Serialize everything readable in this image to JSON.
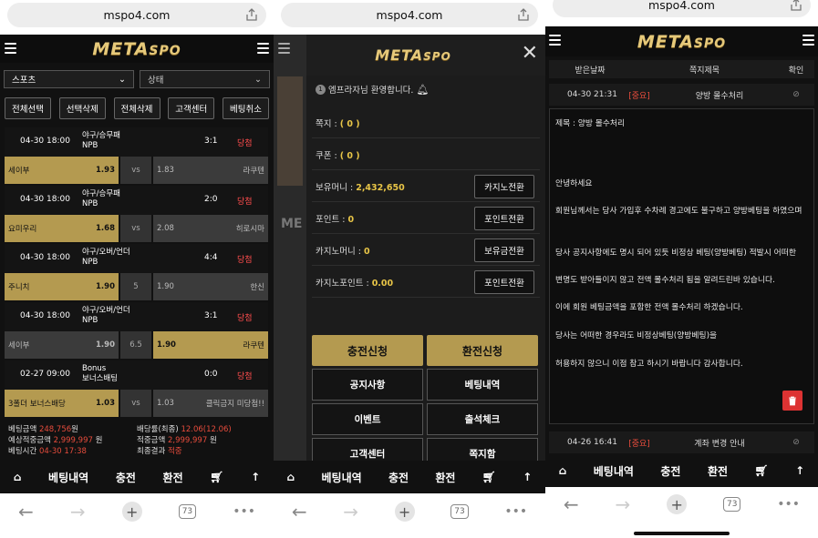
{
  "url": "mspo4.com",
  "logo": {
    "main": "META",
    "sub": "SPO"
  },
  "p1": {
    "sel1": "스포츠",
    "sel2": "상태",
    "btns": [
      "전체선택",
      "선택삭제",
      "전체삭제",
      "고객센터",
      "베팅취소"
    ],
    "bets": [
      {
        "date": "04-30 18:00",
        "league": "야구/승무패",
        "league2": "NPB",
        "score": "3:1",
        "result": "당첨",
        "home": "세이부",
        "hodds": "1.93",
        "mid": "vs",
        "aodds": "1.83",
        "away": "라쿠텐",
        "sel": "home"
      },
      {
        "date": "04-30 18:00",
        "league": "야구/승무패",
        "league2": "NPB",
        "score": "2:0",
        "result": "당첨",
        "home": "요미우리",
        "hodds": "1.68",
        "mid": "vs",
        "aodds": "2.08",
        "away": "히로시마",
        "sel": "home"
      },
      {
        "date": "04-30 18:00",
        "league": "야구/오버/언더",
        "league2": "NPB",
        "score": "4:4",
        "result": "당첨",
        "home": "주니치",
        "hodds": "1.90",
        "mid": "5",
        "aodds": "1.90",
        "away": "한신",
        "sel": "home"
      },
      {
        "date": "04-30 18:00",
        "league": "야구/오버/언더",
        "league2": "NPB",
        "score": "3:1",
        "result": "당첨",
        "home": "세이부",
        "hodds": "1.90",
        "mid": "6.5",
        "aodds": "1.90",
        "away": "라쿠텐",
        "sel": "away"
      },
      {
        "date": "02-27 09:00",
        "league": "Bonus",
        "league2": "보너스배팅",
        "score": "0:0",
        "result": "당첨",
        "home": "3폴더 보너스배당",
        "hodds": "1.03",
        "mid": "vs",
        "aodds": "1.03",
        "away": "클릭금지 미당첨!!",
        "sel": "home"
      }
    ],
    "summary": {
      "l1k": "베팅금액",
      "l1v": "248,756",
      "l1u": "원",
      "l2k": "예상적중금액",
      "l2v": "2,999,997",
      "l2u": "원",
      "l3k": "베팅시간",
      "l3v": "04-30 17:38",
      "r1k": "배당률(최종)",
      "r1v": "12.06(12.06)",
      "r2k": "적중금액",
      "r2v": "2,999,997",
      "r2u": "원",
      "r3k": "최종결과",
      "r3v": "적중"
    }
  },
  "bottom": [
    "베팅내역",
    "충전",
    "환전"
  ],
  "tabs": "73",
  "p2": {
    "welcome": "엠프라자님 환영합니다.",
    "rows": [
      {
        "k": "쪽지 : ",
        "v": "( 0 )"
      },
      {
        "k": "쿠폰 : ",
        "v": "( 0 )"
      },
      {
        "k": "보유머니 : ",
        "v": "2,432,650",
        "b": "카지노전환"
      },
      {
        "k": "포인트 : ",
        "v": "0",
        "b": "포인트전환"
      },
      {
        "k": "카지노머니 : ",
        "v": "0",
        "b": "보유금전환"
      },
      {
        "k": "카지노포인트 : ",
        "v": "0.00",
        "b": "포인트전환"
      }
    ],
    "big": [
      "충전신청",
      "환전신청"
    ],
    "menu": [
      "공지사항",
      "베팅내역",
      "이벤트",
      "출석체크",
      "고객센터",
      "쪽지함"
    ]
  },
  "p3": {
    "head": [
      "받은날짜",
      "쪽지제목",
      "확인"
    ],
    "msg": {
      "date": "04-30 21:31",
      "tag": "[중요]",
      "title": "양방 몰수처리"
    },
    "subject": "제목 : 양방 몰수처리",
    "body": [
      "안녕하세요",
      "회원님께서는 당사 가입후 수차례 경고에도 불구하고 양방베팅을 하였으며",
      "당사 공지사항에도 명시 되어 있듯 비정상 베팅(양방베팅) 적발시 어떠한",
      "변명도 받아들이지 않고 전액 몰수처리 됨을 알려드린바 있습니다.",
      "이에 회원 베팅금액을 포함한 전액 몰수처리 하겠습니다.",
      "당사는 어떠한 경우라도 비정상베팅(양방베팅)을",
      "허용하지 않으니 이점 참고 하시기 바랍니다 감사합니다."
    ],
    "msg2": {
      "date": "04-26 16:41",
      "tag": "[중요]",
      "title": "계좌 변경 안내"
    }
  }
}
